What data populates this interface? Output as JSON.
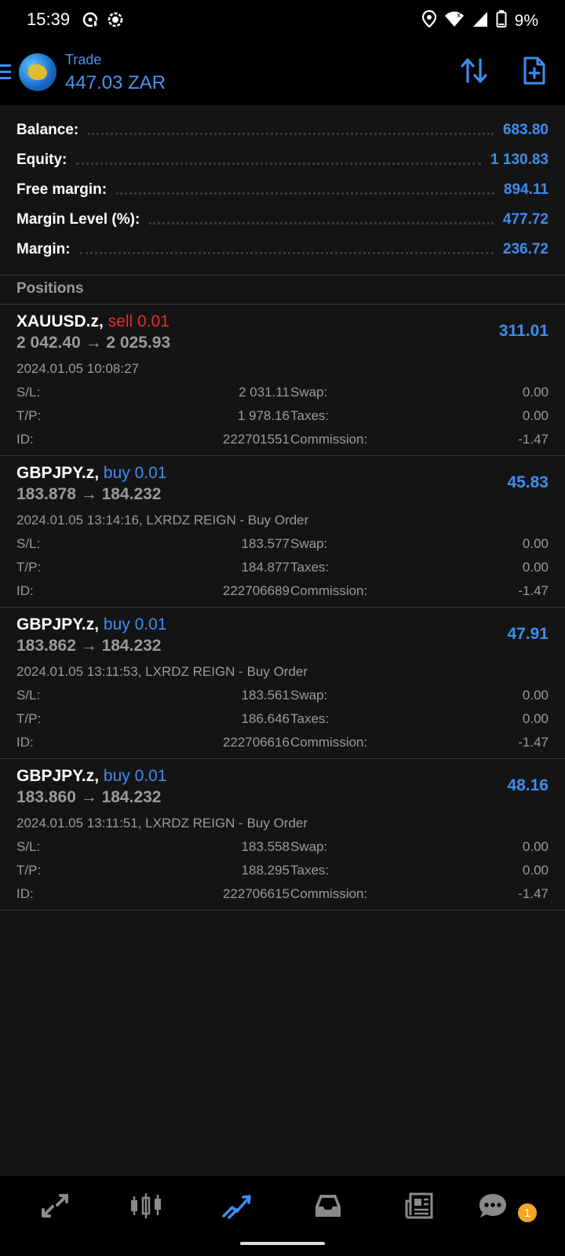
{
  "status_bar": {
    "time": "15:39",
    "battery": "9%",
    "icons": [
      "media-icon",
      "circle-dot-icon",
      "location-icon",
      "wifi-icon",
      "signal-icon",
      "battery-icon"
    ]
  },
  "header": {
    "title": "Trade",
    "subtitle": "447.03 ZAR",
    "accent_color": "#3d8ef0"
  },
  "summary": [
    {
      "label": "Balance:",
      "value": "683.80"
    },
    {
      "label": "Equity:",
      "value": "1 130.83"
    },
    {
      "label": "Free margin:",
      "value": "894.11"
    },
    {
      "label": "Margin Level (%):",
      "value": "477.72"
    },
    {
      "label": "Margin:",
      "value": "236.72"
    }
  ],
  "positions_header": "Positions",
  "positions": [
    {
      "symbol": "XAUUSD.z,",
      "side": "sell 0.01",
      "side_type": "sell",
      "prices": "2 042.40 → 2 025.93",
      "profit": "311.01",
      "time": "2024.01.05 10:08:27",
      "sl_label": "S/L:",
      "sl": "2 031.11",
      "swap_label": "Swap:",
      "swap": "0.00",
      "tp_label": "T/P:",
      "tp": "1 978.16",
      "taxes_label": "Taxes:",
      "taxes": "0.00",
      "id_label": "ID:",
      "id": "222701551",
      "commission_label": "Commission:",
      "commission": "-1.47"
    },
    {
      "symbol": "GBPJPY.z,",
      "side": "buy 0.01",
      "side_type": "buy",
      "prices": "183.878 → 184.232",
      "profit": "45.83",
      "time": "2024.01.05 13:14:16, LXRDZ REIGN - Buy Order",
      "sl_label": "S/L:",
      "sl": "183.577",
      "swap_label": "Swap:",
      "swap": "0.00",
      "tp_label": "T/P:",
      "tp": "184.877",
      "taxes_label": "Taxes:",
      "taxes": "0.00",
      "id_label": "ID:",
      "id": "222706689",
      "commission_label": "Commission:",
      "commission": "-1.47"
    },
    {
      "symbol": "GBPJPY.z,",
      "side": "buy 0.01",
      "side_type": "buy",
      "prices": "183.862 → 184.232",
      "profit": "47.91",
      "time": "2024.01.05 13:11:53, LXRDZ REIGN - Buy Order",
      "sl_label": "S/L:",
      "sl": "183.561",
      "swap_label": "Swap:",
      "swap": "0.00",
      "tp_label": "T/P:",
      "tp": "186.646",
      "taxes_label": "Taxes:",
      "taxes": "0.00",
      "id_label": "ID:",
      "id": "222706616",
      "commission_label": "Commission:",
      "commission": "-1.47"
    },
    {
      "symbol": "GBPJPY.z,",
      "side": "buy 0.01",
      "side_type": "buy",
      "prices": "183.860 → 184.232",
      "profit": "48.16",
      "time": "2024.01.05 13:11:51, LXRDZ REIGN - Buy Order",
      "sl_label": "S/L:",
      "sl": "183.558",
      "swap_label": "Swap:",
      "swap": "0.00",
      "tp_label": "T/P:",
      "tp": "188.295",
      "taxes_label": "Taxes:",
      "taxes": "0.00",
      "id_label": "ID:",
      "id": "222706615",
      "commission_label": "Commission:",
      "commission": "-1.47"
    }
  ],
  "bottom_nav": {
    "items": [
      "quotes-icon",
      "chart-icon",
      "trade-icon",
      "history-icon",
      "news-icon",
      "chat-icon"
    ],
    "active": "trade-icon",
    "chat_badge": "1",
    "badge_color": "#f5a623"
  }
}
